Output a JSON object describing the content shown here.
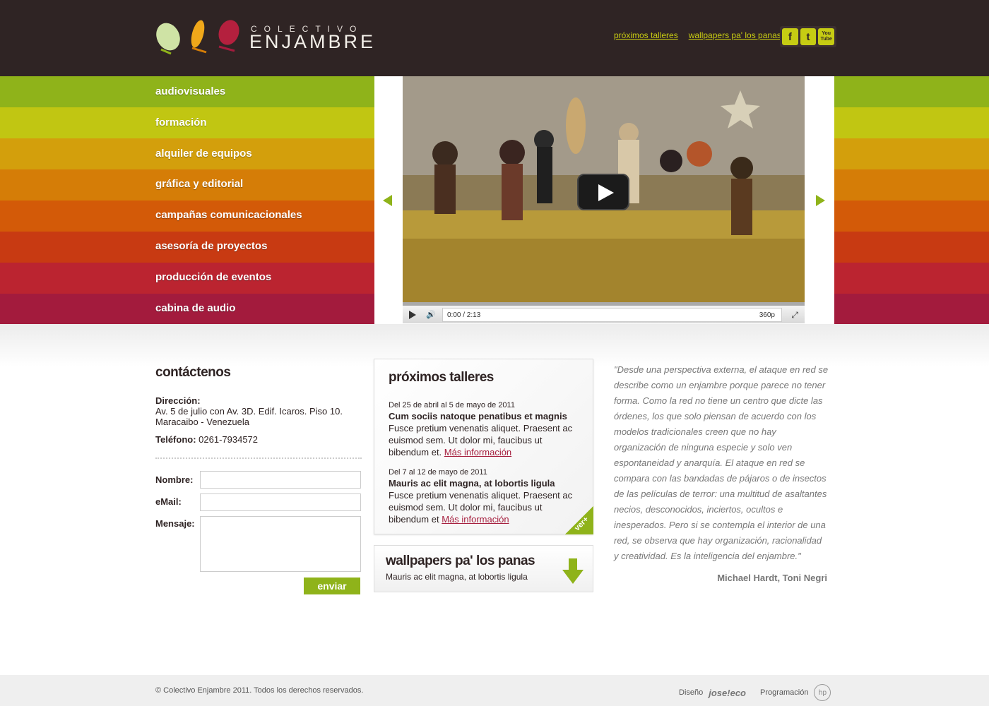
{
  "header": {
    "logo_small": "COLECTIVO",
    "logo_big": "ENJAMBRE",
    "links": [
      "próximos talleres",
      "wallpapers pa' los panas"
    ],
    "social": {
      "facebook": "f",
      "twitter": "t",
      "youtube": "You Tube"
    }
  },
  "nav": {
    "items": [
      {
        "label": "audiovisuales",
        "color": "#8fb31a"
      },
      {
        "label": "formación",
        "color": "#c1c612"
      },
      {
        "label": "alquiler de equipos",
        "color": "#d39f0c"
      },
      {
        "label": "gráfica y editorial",
        "color": "#d57d07"
      },
      {
        "label": "campañas comunicacionales",
        "color": "#d35a08"
      },
      {
        "label": "asesoría de proyectos",
        "color": "#c83a12"
      },
      {
        "label": "producción de eventos",
        "color": "#bb2430"
      },
      {
        "label": "cabina de audio",
        "color": "#a31b3d"
      }
    ]
  },
  "video": {
    "time": "0:00 / 2:13",
    "quality": "360p"
  },
  "contact": {
    "title": "contáctenos",
    "address_label": "Dirección:",
    "address_line1": "Av. 5 de julio con Av. 3D. Edif. Icaros. Piso 10.",
    "address_line2": "Maracaibo - Venezuela",
    "phone_label": "Teléfono:",
    "phone": "0261-7934572",
    "form": {
      "name_label": "Nombre:",
      "email_label": "eMail:",
      "message_label": "Mensaje:",
      "send_label": "enviar"
    }
  },
  "talleres": {
    "title": "próximos talleres",
    "events": [
      {
        "date": "Del 25 de abril al 5 de mayo de 2011",
        "title": "Cum sociis natoque penatibus et magnis",
        "text": "Fusce pretium venenatis aliquet. Praesent ac euismod sem. Ut dolor mi, faucibus ut bibendum et.",
        "link": "Más información"
      },
      {
        "date": "Del 7 al 12 de mayo de 2011",
        "title": "Mauris ac elit magna, at lobortis ligula",
        "text": "Fusce pretium venenatis aliquet. Praesent ac euismod sem. Ut dolor mi, faucibus ut bibendum et",
        "link": "Más información"
      }
    ],
    "more": "ver+"
  },
  "wallpapers": {
    "title": "wallpapers pa' los panas",
    "subtitle": "Mauris ac elit magna, at lobortis ligula"
  },
  "quote": {
    "text": "\"Desde una perspectiva externa, el ataque en red se describe como un enjambre porque parece no tener forma. Como la red no tiene un centro que dicte las órdenes, los que solo piensan de acuerdo con los modelos tradicionales creen que no hay organización de ninguna especie y solo ven espontaneidad y anarquía. El ataque en red se compara con las bandadas de pájaros o de insectos de las películas de terror: una multitud de asaltantes necios, desconocidos, inciertos, ocultos e inesperados. Pero si se contempla el interior de una red, se observa que hay organización, racionalidad y creatividad. Es la inteligencia del enjambre.\"",
    "author": "Michael Hardt, Toni Negri"
  },
  "footer": {
    "copyright": "© Colectivo Enjambre 2011. Todos los derechos reservados.",
    "design_label": "Diseño",
    "design_brand": "jose!eco",
    "programming_label": "Programación",
    "programming_brand": "hp"
  }
}
